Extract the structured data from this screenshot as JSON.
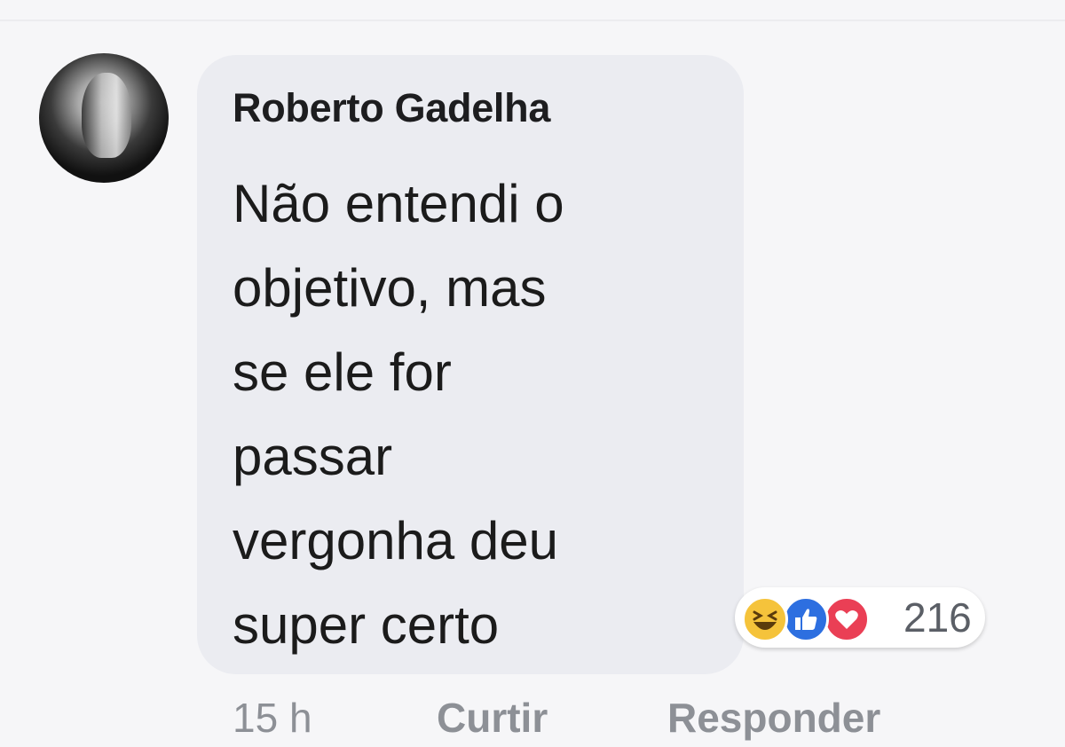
{
  "comment": {
    "author": "Roberto Gadelha",
    "text": "Não entendi o\nobjetivo, mas\nse ele for\npassar\nvergonha deu\nsuper certo"
  },
  "reactions": {
    "icons": [
      "haha-icon",
      "like-icon",
      "love-icon"
    ],
    "count": "216",
    "colors": {
      "haha": "#f5c33b",
      "like": "#2d6fe0",
      "love": "#ea3f55"
    }
  },
  "actions": {
    "time": "15 h",
    "like_label": "Curtir",
    "reply_label": "Responder"
  }
}
